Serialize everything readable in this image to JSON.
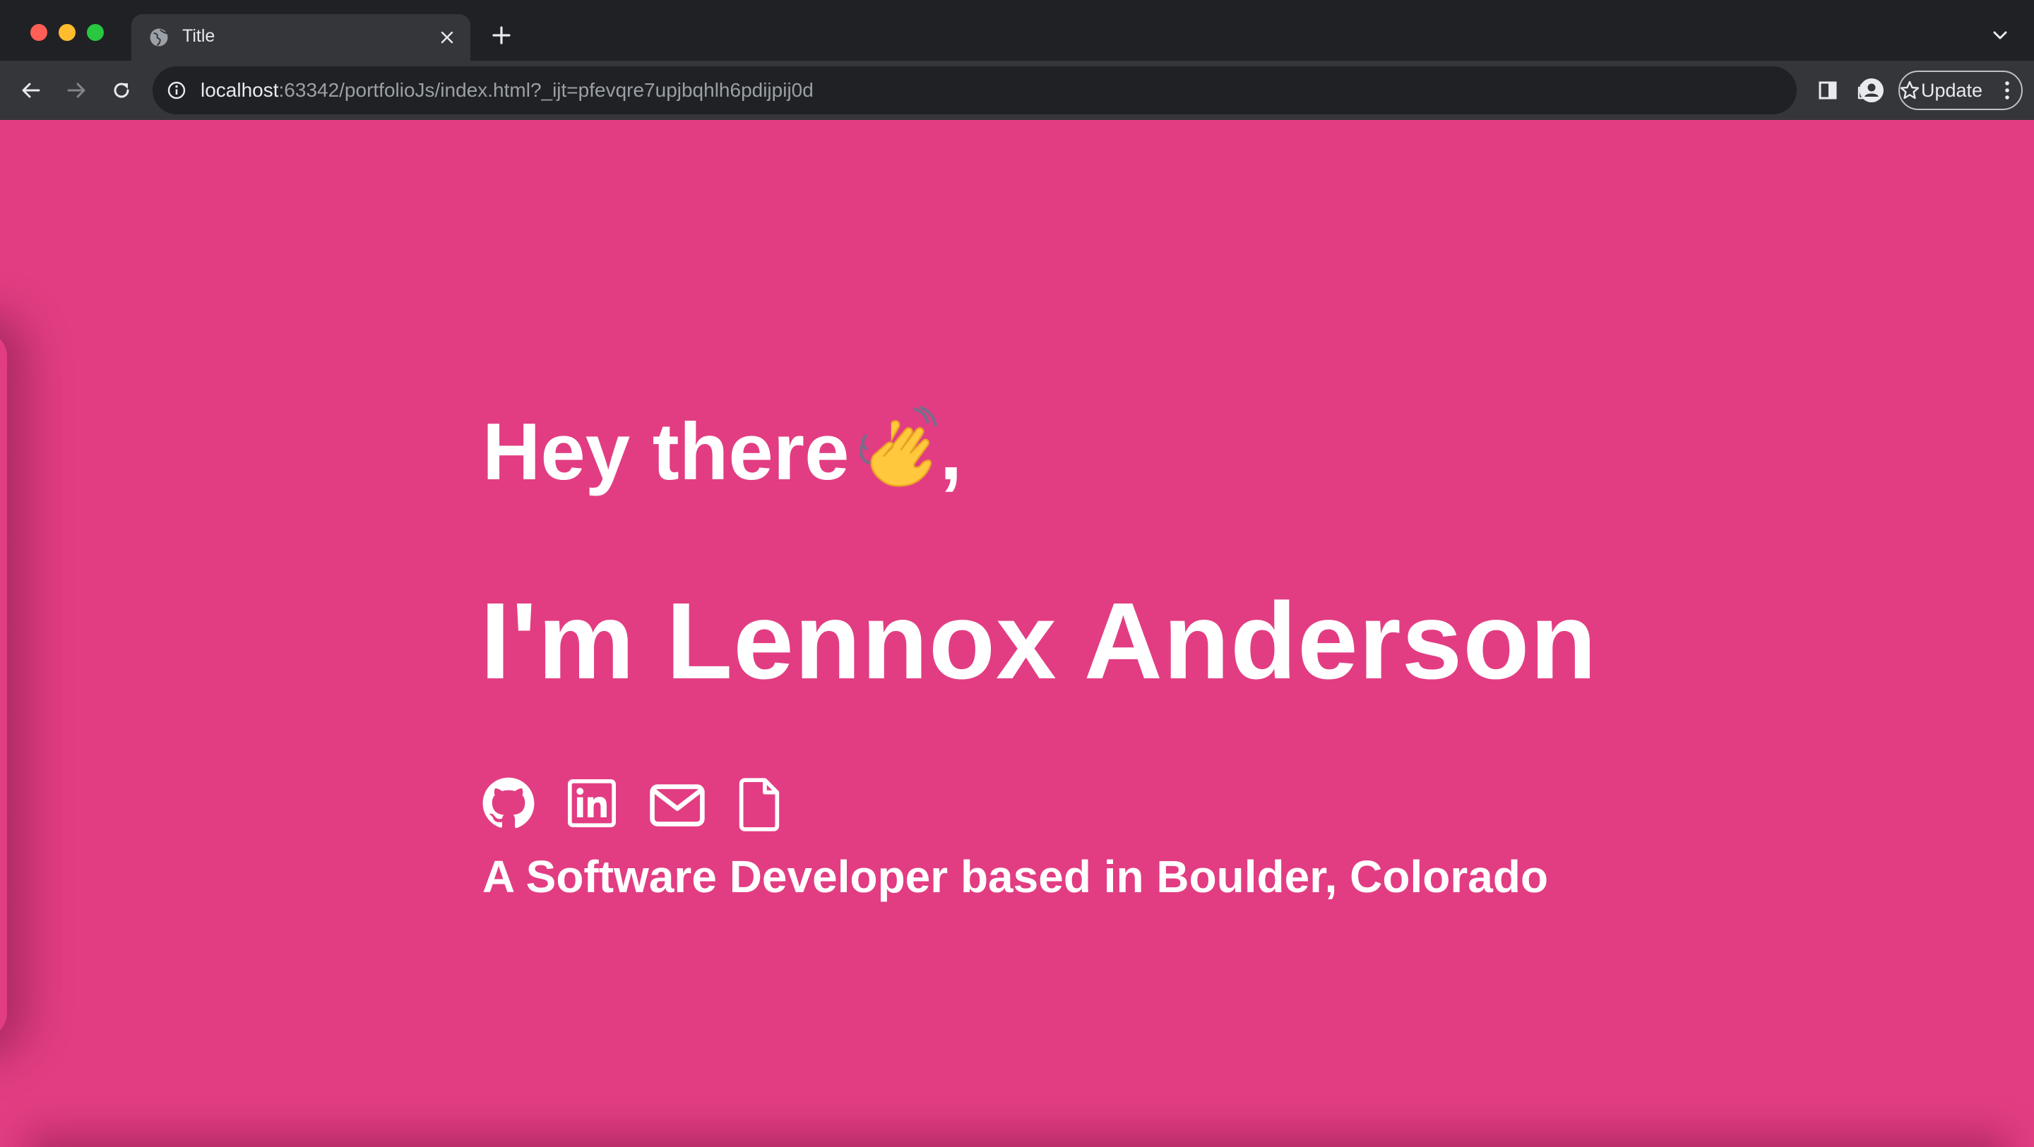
{
  "browser": {
    "tab_title": "Title",
    "url_host": "localhost",
    "url_rest": ":63342/portfolioJs/index.html?_ijt=pfevqre7upjbqhlh6pdijpij0d",
    "update_label": "Update"
  },
  "hero": {
    "greeting_text": "Hey there",
    "greeting_punct": ",",
    "greeting_emoji": "waving-hand",
    "name": "I'm Lennox Anderson",
    "tagline": "A Software Developer based in Boulder, Colorado"
  },
  "social_links": [
    {
      "icon": "github-icon"
    },
    {
      "icon": "linkedin-icon"
    },
    {
      "icon": "email-icon"
    },
    {
      "icon": "resume-icon"
    }
  ],
  "colors": {
    "page_background": "#e23d82",
    "text": "#ffffff",
    "chrome_dark": "#202124",
    "chrome_toolbar": "#35363a"
  }
}
